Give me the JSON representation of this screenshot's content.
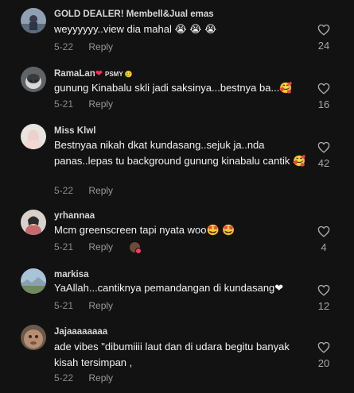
{
  "comments": [
    {
      "username": "GOLD DEALER! Membell&Jual emas",
      "text": "weyyyyyy..view dia mahal 😭 😭 😭",
      "date": "5-22",
      "reply_label": "Reply",
      "likes": "24",
      "avatar": "gold-dealer-avatar"
    },
    {
      "username": "RamaLan",
      "username_heart": "❤",
      "username_tag": "PSMY 🥲",
      "text": "gunung Kinabalu skli jadi saksinya...bestnya ba...🥰",
      "date": "5-21",
      "reply_label": "Reply",
      "likes": "16",
      "avatar": "cat-avatar"
    },
    {
      "username": "Miss Klwl",
      "text": "Bestnyaa nikah dkat kundasang..sejuk ja..nda panas..lepas tu background gunung kinabalu cantik 🥰",
      "date": "5-22",
      "reply_label": "Reply",
      "likes": "42",
      "avatar": "hijab-woman-avatar"
    },
    {
      "username": "yrhannaa",
      "text": "Mcm greenscreen tapi nyata woo🤩 🤩",
      "date": "5-21",
      "reply_label": "Reply",
      "likes": "4",
      "avatar": "yrhannaa-avatar"
    },
    {
      "username": "markisa",
      "text": "YaAllah...cantiknya pemandangan di kundasang❤",
      "date": "5-21",
      "reply_label": "Reply",
      "likes": "12",
      "avatar": "landscape-avatar"
    },
    {
      "username": "Jajaaaaaaaa",
      "text": "ade vibes \"dibumiiii laut dan di udara begitu banyak kisah tersimpan ,",
      "date": "5-22",
      "reply_label": "Reply",
      "likes": "20",
      "avatar": "face-avatar"
    }
  ]
}
